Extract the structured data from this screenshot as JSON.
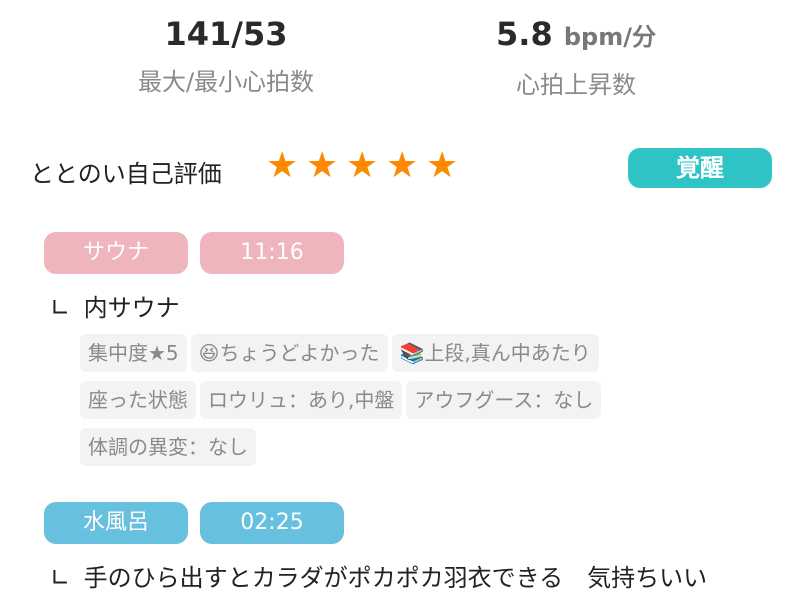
{
  "stats": {
    "heart_rate": {
      "value": "141/53",
      "label": "最大/最小心拍数"
    },
    "hr_rise": {
      "value": "5.8",
      "unit": "bpm/分",
      "label": "心拍上昇数"
    }
  },
  "rating": {
    "label": "ととのい自己評価",
    "stars": 5,
    "star_color": "#ff8a00",
    "badge": "覚醒",
    "badge_color": "#2ec4c6"
  },
  "sauna": {
    "name": "サウナ",
    "time": "11:16",
    "color": "#eeb5bc",
    "sub_title": "内サウナ",
    "tags": [
      "集中度★5",
      "😆ちょうどよかった",
      "📚上段,真ん中あたり",
      "座った状態",
      "ロウリュ：あり,中盤",
      "アウフグース：なし",
      "体調の異変：なし"
    ]
  },
  "water_bath": {
    "name": "水風呂",
    "time": "02:25",
    "color": "#67c0de",
    "sub_title": "手のひら出すとカラダがポカポカ羽衣できる　気持ちいい"
  },
  "glyphs": {
    "corner": "∟",
    "star": "★"
  }
}
